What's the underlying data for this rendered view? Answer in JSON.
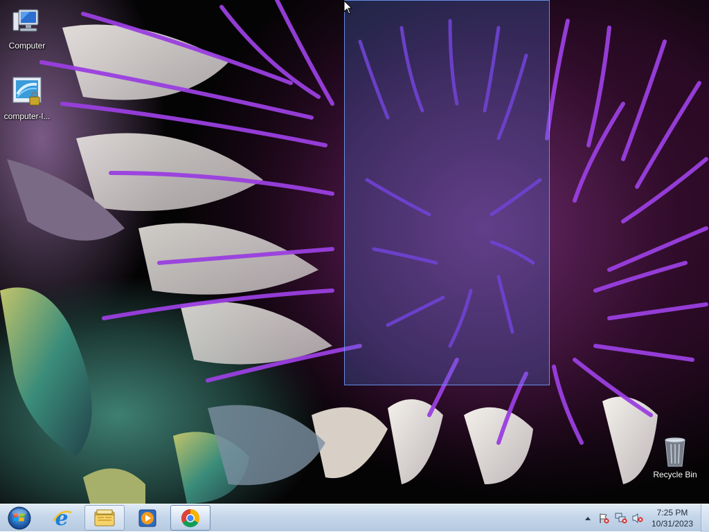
{
  "desktop": {
    "icons": [
      {
        "label": "Computer",
        "icon": "computer-icon"
      },
      {
        "label": "computer-l...",
        "icon": "network-lock-icon"
      },
      {
        "label": "Recycle Bin",
        "icon": "recycle-bin-icon"
      }
    ]
  },
  "taskbar": {
    "start_icon": "windows-orb-icon",
    "items": [
      {
        "name": "Internet Explorer",
        "icon": "internet-explorer-icon"
      },
      {
        "name": "Windows Explorer",
        "icon": "folder-icon"
      },
      {
        "name": "Windows Media Player",
        "icon": "media-player-icon"
      },
      {
        "name": "Google Chrome",
        "icon": "chrome-icon"
      }
    ],
    "tray": {
      "icons": [
        "show-hidden-icons-icon",
        "action-center-alert-icon",
        "network-disconnected-icon",
        "volume-muted-icon"
      ],
      "time": "7:25 PM",
      "date": "10/31/2023"
    }
  }
}
